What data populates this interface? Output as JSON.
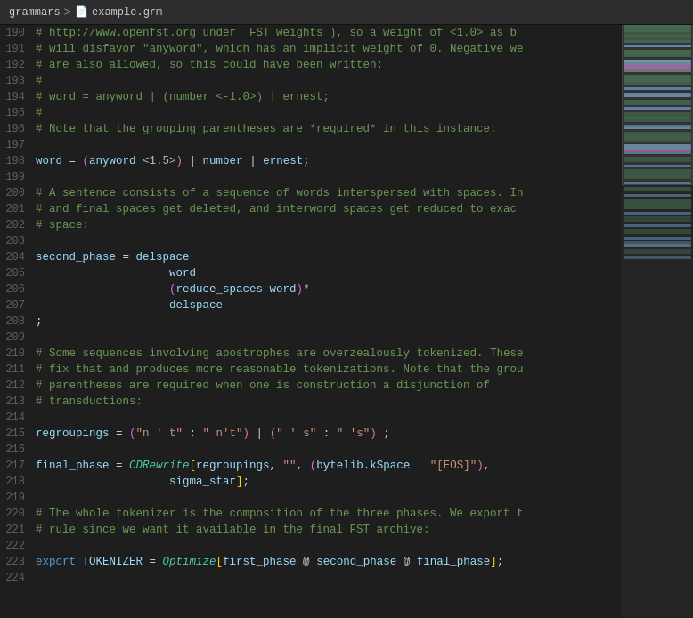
{
  "titlebar": {
    "folder": "grammars",
    "sep": ">",
    "file_icon": "📄",
    "filename": "example.grm"
  },
  "lines": [
    {
      "num": "190",
      "tokens": [
        {
          "t": "# http://www.openfst.org under  FST weights ), so a weight of <1.0> as b",
          "c": "c-comment"
        }
      ]
    },
    {
      "num": "191",
      "tokens": [
        {
          "t": "# will disfavor \"anyword\", which has an implicit weight of 0. Negative we",
          "c": "c-comment"
        }
      ]
    },
    {
      "num": "192",
      "tokens": [
        {
          "t": "# are also allowed, so this could have been written:",
          "c": "c-comment"
        }
      ]
    },
    {
      "num": "193",
      "tokens": [
        {
          "t": "#",
          "c": "c-comment"
        }
      ]
    },
    {
      "num": "194",
      "tokens": [
        {
          "t": "# word = anyword | (number <-1.0>) | ernest;",
          "c": "c-comment"
        }
      ]
    },
    {
      "num": "195",
      "tokens": [
        {
          "t": "#",
          "c": "c-comment"
        }
      ]
    },
    {
      "num": "196",
      "tokens": [
        {
          "t": "# Note that the grouping parentheses are *required* in this instance:",
          "c": "c-comment"
        }
      ]
    },
    {
      "num": "197",
      "tokens": []
    },
    {
      "num": "198",
      "raw": true,
      "content": "word_assign"
    },
    {
      "num": "199",
      "tokens": []
    },
    {
      "num": "200",
      "tokens": [
        {
          "t": "# A sentence consists of a sequence of words interspersed with spaces. In",
          "c": "c-comment"
        }
      ]
    },
    {
      "num": "201",
      "tokens": [
        {
          "t": "# and final spaces get deleted, and interword spaces get reduced to exac",
          "c": "c-comment"
        }
      ]
    },
    {
      "num": "202",
      "tokens": [
        {
          "t": "# space:",
          "c": "c-comment"
        }
      ]
    },
    {
      "num": "203",
      "tokens": []
    },
    {
      "num": "204",
      "tokens": [
        {
          "t": "second_phase",
          "c": "c-variable"
        },
        {
          "t": " = ",
          "c": "c-assign"
        },
        {
          "t": "delspace",
          "c": "c-variable"
        }
      ]
    },
    {
      "num": "205",
      "tokens": [
        {
          "t": "                    word",
          "c": "c-variable"
        }
      ]
    },
    {
      "num": "206",
      "raw": true,
      "content": "reduce_spaces_line"
    },
    {
      "num": "207",
      "tokens": [
        {
          "t": "                    delspace",
          "c": "c-variable"
        }
      ]
    },
    {
      "num": "208",
      "tokens": [
        {
          "t": ";",
          "c": "c-operator"
        }
      ]
    },
    {
      "num": "209",
      "tokens": []
    },
    {
      "num": "210",
      "tokens": [
        {
          "t": "# Some sequences involving apostrophes are overzealously tokenized. These",
          "c": "c-comment"
        }
      ]
    },
    {
      "num": "211",
      "tokens": [
        {
          "t": "# fix that and produces more reasonable tokenizations. Note that the grou",
          "c": "c-comment"
        }
      ]
    },
    {
      "num": "212",
      "tokens": [
        {
          "t": "# parentheses are required when one is construction a disjunction of",
          "c": "c-comment"
        }
      ]
    },
    {
      "num": "213",
      "tokens": [
        {
          "t": "# transductions:",
          "c": "c-comment"
        }
      ]
    },
    {
      "num": "214",
      "tokens": []
    },
    {
      "num": "215",
      "raw": true,
      "content": "regroupings_line"
    },
    {
      "num": "216",
      "tokens": []
    },
    {
      "num": "217",
      "raw": true,
      "content": "final_phase_line"
    },
    {
      "num": "218",
      "tokens": [
        {
          "t": "                    sigma_star",
          "c": "c-variable"
        },
        {
          "t": "];",
          "c": "c-operator"
        }
      ]
    },
    {
      "num": "219",
      "tokens": []
    },
    {
      "num": "220",
      "tokens": [
        {
          "t": "# The whole tokenizer is the composition of the three phases. We export t",
          "c": "c-comment"
        }
      ]
    },
    {
      "num": "221",
      "tokens": [
        {
          "t": "# rule since we want it available in the final FST archive:",
          "c": "c-comment"
        }
      ]
    },
    {
      "num": "222",
      "tokens": []
    },
    {
      "num": "223",
      "raw": true,
      "content": "export_line"
    },
    {
      "num": "224",
      "tokens": []
    }
  ]
}
